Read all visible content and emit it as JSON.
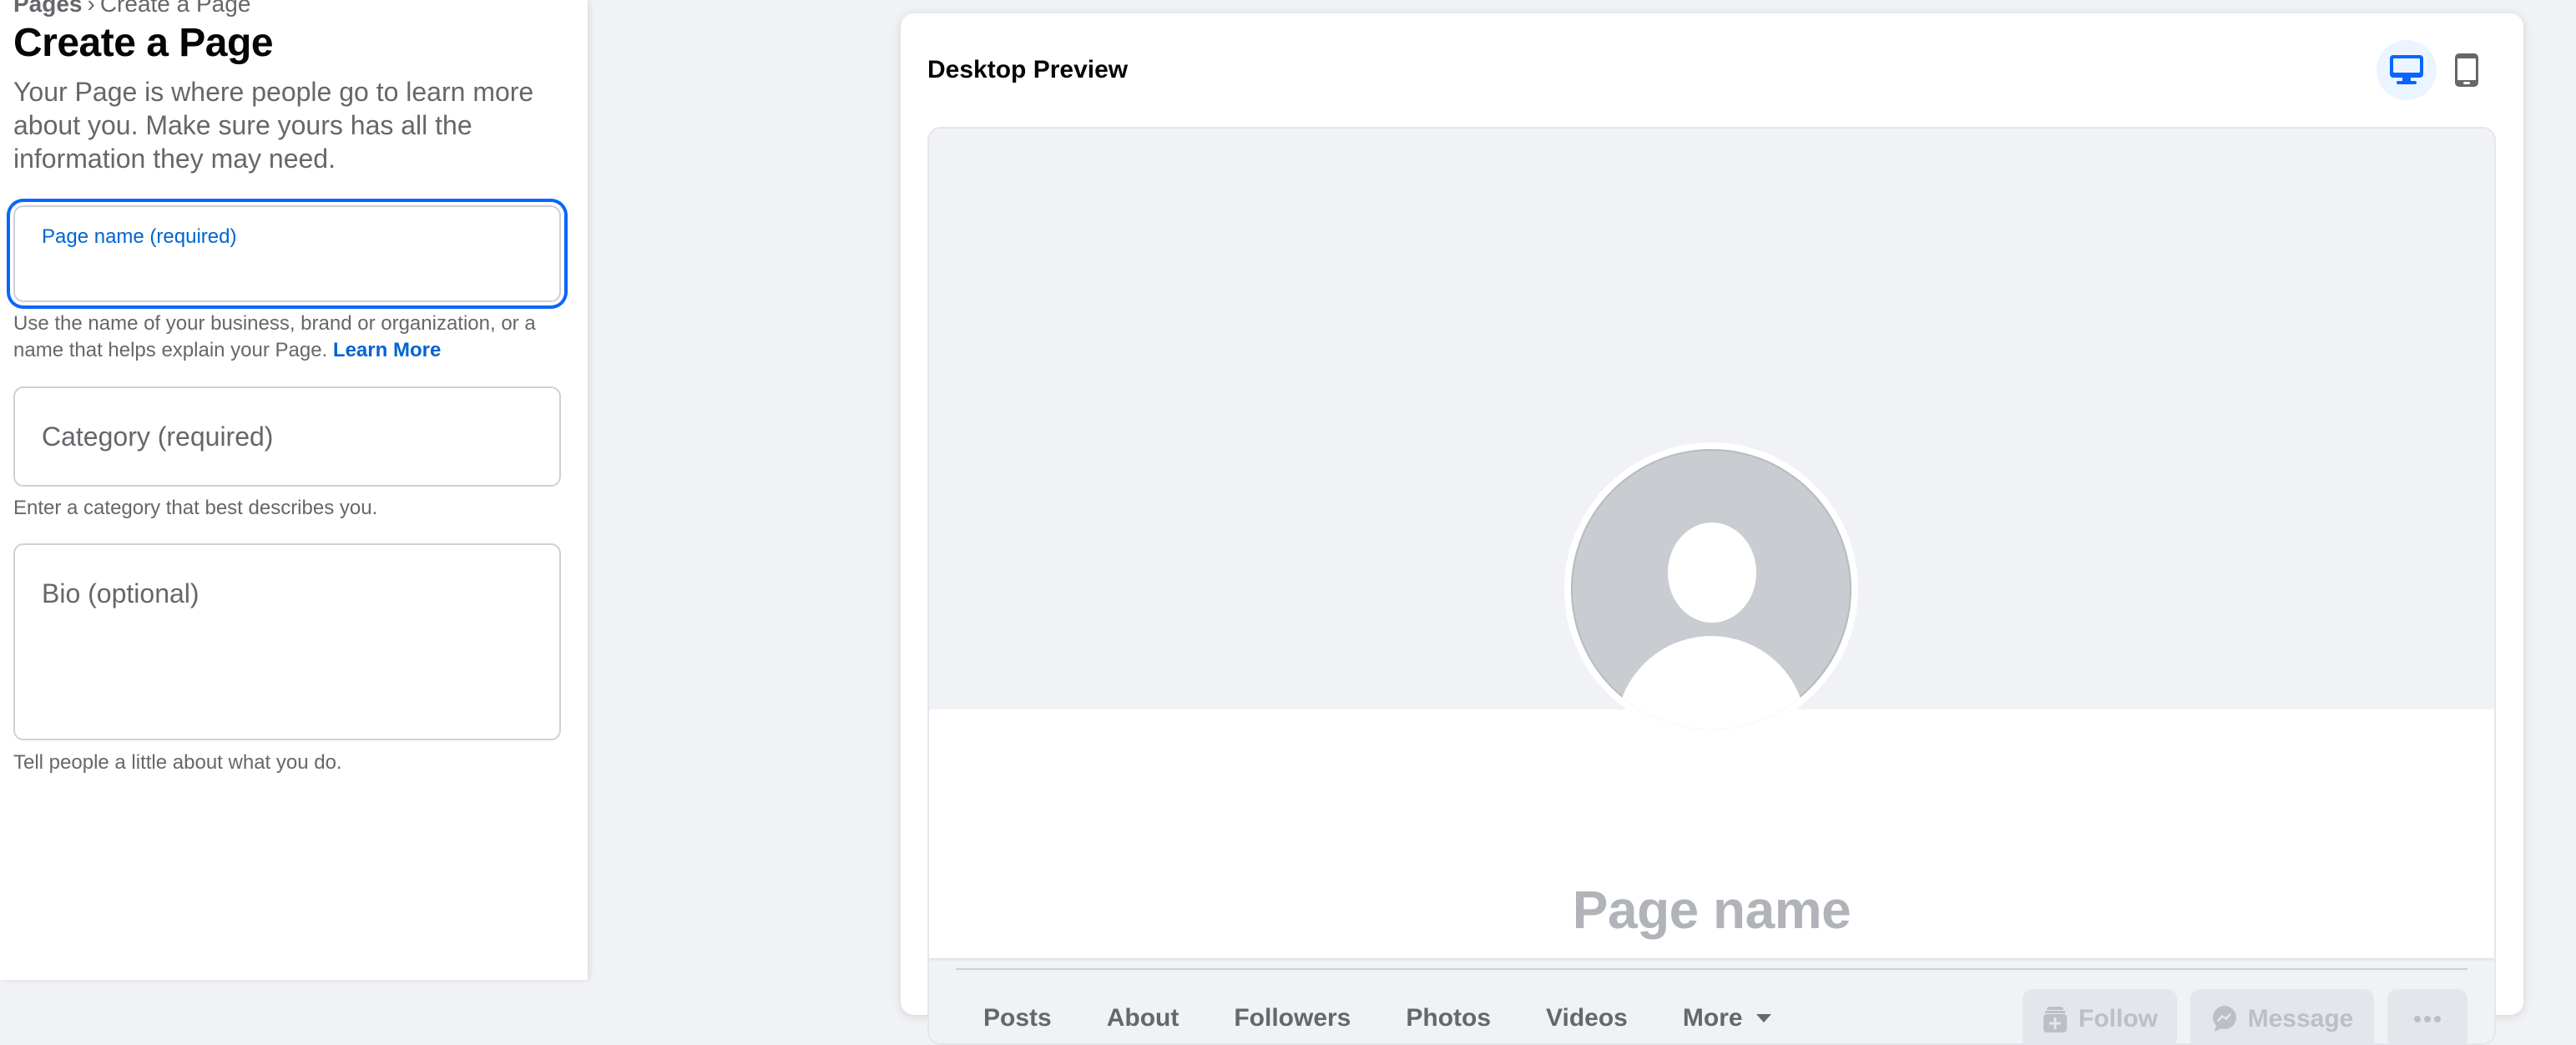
{
  "breadcrumb": {
    "root": "Pages",
    "separator": "›",
    "current": "Create a Page"
  },
  "form": {
    "title": "Create a Page",
    "description": "Your Page is where people go to learn more about you. Make sure yours has all the information they may need.",
    "fields": {
      "page_name": {
        "label": "Page name (required)",
        "value": "",
        "helper": "Use the name of your business, brand or organization, or a name that helps explain your Page.",
        "helper_link": "Learn More",
        "focused": true
      },
      "category": {
        "label": "Category (required)",
        "value": "",
        "helper": "Enter a category that best describes you."
      },
      "bio": {
        "label": "Bio (optional)",
        "value": "",
        "helper": "Tell people a little about what you do."
      }
    }
  },
  "preview": {
    "title": "Desktop Preview",
    "view_modes": [
      {
        "name": "desktop",
        "icon": "desktop-monitor-icon",
        "selected": true
      },
      {
        "name": "mobile",
        "icon": "mobile-phone-icon",
        "selected": false
      }
    ],
    "page_name_placeholder": "Page name",
    "tabs": [
      "Posts",
      "About",
      "Followers",
      "Photos",
      "Videos",
      "More"
    ],
    "actions": {
      "follow": "Follow",
      "message": "Message",
      "more_icon": "ellipsis-icon"
    }
  },
  "colors": {
    "accent": "#0866ff",
    "link": "#0064d1",
    "secondary_text": "#65676b",
    "disabled_text": "#bcc0c4",
    "background": "#f0f2f5"
  }
}
